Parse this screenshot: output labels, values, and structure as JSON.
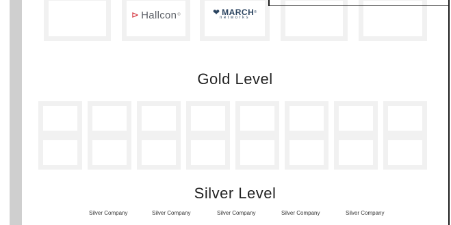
{
  "top_logos": {
    "hallcon": {
      "name": "Hallcon",
      "mark": "⊳",
      "sup": "®"
    },
    "march": {
      "name": "MARCH",
      "sub": "networks",
      "sup": "®"
    }
  },
  "gold_heading": "Gold Level",
  "silver_heading": "Silver Level",
  "silver_companies": [
    "Silver Company",
    "Silver Company",
    "Silver Company",
    "Silver Company",
    "Silver Company"
  ],
  "colors": {
    "rail": "#cfcfcf",
    "tile_border": "#f1f1f1",
    "hallcon_red": "#d3303a",
    "march_blue": "#2b4460"
  }
}
